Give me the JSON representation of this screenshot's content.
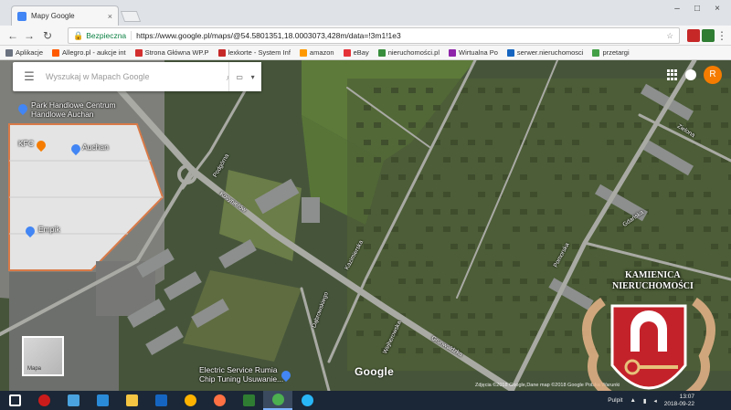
{
  "browser": {
    "tab_title": "Mapy Google",
    "tab_close": "×",
    "window_controls": [
      "–",
      "□",
      "×"
    ],
    "secure_label": "Bezpieczna",
    "url": "https://www.google.pl/maps/@54.5801351,18.0003073,428m/data=!3m1!1e3",
    "star": "☆",
    "bookmarks": [
      {
        "label": "Aplikacje",
        "color": "#6b7280"
      },
      {
        "label": "Allegro.pl - aukcje int",
        "color": "#ff5a00"
      },
      {
        "label": "Strona Główna WP.P",
        "color": "#d32f2f"
      },
      {
        "label": "lexkorte - System Inf",
        "color": "#c62828"
      },
      {
        "label": "amazon",
        "color": "#ff9900"
      },
      {
        "label": "eBay",
        "color": "#e53238"
      },
      {
        "label": "nieruchomości.pl",
        "color": "#388e3c"
      },
      {
        "label": "Wirtualna Po",
        "color": "#8e24aa"
      },
      {
        "label": "serwer.nieruchomosci",
        "color": "#1565c0"
      },
      {
        "label": "przetargi",
        "color": "#43a047"
      }
    ]
  },
  "maps": {
    "search_placeholder": "Wyszukaj w Mapach Google",
    "labels": {
      "centrum": "Park Handlowe Centrum",
      "centrum2": "Handlowe Auchan",
      "kfc": "KFC",
      "auchan": "Auchan",
      "empik": "Empik",
      "service": "Electric Service Rumia",
      "service2": "Chip Tuning Usuwanie..."
    },
    "streets": {
      "kosynierow": "Kosynierów",
      "podgorna": "Podgórna",
      "kazimierz": "Kazimierska",
      "grunwaldzka": "Grunwaldzka",
      "dabrowskiego": "Dąbrowskiego",
      "pomorska": "Pomorska",
      "gdanska": "Gdańska",
      "wejherowska": "Wejherowska",
      "zielona": "Zielona"
    },
    "avatar_letter": "R",
    "minimap_label": "Mapa",
    "logo": "Google",
    "copyright": "Zdjęcia ©2018 Google,Dane map ©2018 Google    Polska    Warunki"
  },
  "watermark": {
    "line1": "KAMIENICA",
    "line2": "NIERUCHOMOŚCI"
  },
  "taskbar": {
    "apps": [
      {
        "name": "windows",
        "color": "#ffffff"
      },
      {
        "name": "opera",
        "color": "#cc1b1b"
      },
      {
        "name": "remote",
        "color": "#4aa3df"
      },
      {
        "name": "ie",
        "color": "#2a8bd8"
      },
      {
        "name": "explorer",
        "color": "#f4c542"
      },
      {
        "name": "outlook",
        "color": "#1565c0"
      },
      {
        "name": "smiley",
        "color": "#ffb300"
      },
      {
        "name": "firefox",
        "color": "#ff7043"
      },
      {
        "name": "excel",
        "color": "#2e7d32"
      },
      {
        "name": "chrome",
        "color": "#4caf50"
      },
      {
        "name": "skype",
        "color": "#29b6f6"
      }
    ],
    "active_index": 9,
    "tray_label": "Pulpit",
    "time": "13:07",
    "date": "2018-09-22"
  }
}
